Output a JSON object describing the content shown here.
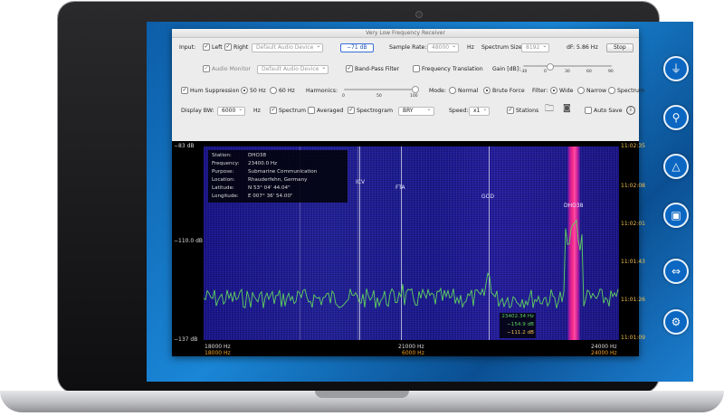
{
  "window": {
    "title": "Very Low Frequency Receiver"
  },
  "row1": {
    "input_label": "Input:",
    "left_label": "Left",
    "right_label": "Right",
    "device": "Default Audio Device",
    "level": "−71 dB",
    "sample_rate_label": "Sample Rate:",
    "sample_rate": "48000",
    "hz": "Hz",
    "spectrum_size_label": "Spectrum Size:",
    "spectrum_size": "8192",
    "df": "dF: 5.86 Hz",
    "stop_label": "Stop"
  },
  "row2": {
    "audio_monitor_label": "Audio Monitor",
    "device": "Default Audio Device",
    "bandpass_label": "Band-Pass Filter",
    "freq_translation_label": "Frequency Translation",
    "gain_label": "Gain [dB]:",
    "gain_ticks": [
      "-30",
      "0",
      "30",
      "60",
      "90"
    ],
    "gain_value": 0.3
  },
  "row3": {
    "hum_label": "Hum Suppression",
    "hz50": "50 Hz",
    "hz60": "60 Hz",
    "harmonics_label": "Harmonics:",
    "harm_ticks": [
      "0",
      "50",
      "100"
    ],
    "harm_value": 1.0,
    "mode_label": "Mode:",
    "normal": "Normal",
    "brute": "Brute Force",
    "filter_label": "Filter:",
    "wide": "Wide",
    "narrow": "Narrow",
    "spectrum": "Spectrum"
  },
  "row4": {
    "display_bw_label": "Display BW:",
    "bw": "6000",
    "hz": "Hz",
    "spectrum_label": "Spectrum",
    "averaged_label": "Averaged",
    "spectrogram_label": "Spectrogram",
    "palette": "BRY",
    "speed_label": "Speed:",
    "speed": "x1",
    "stations_label": "Stations",
    "autosave_label": "Auto Save"
  },
  "plot": {
    "y_top": "−83 dB",
    "y_mid": "−110.0 dB",
    "y_bot": "−137 dB",
    "times": [
      "11:02:35",
      "11:02:08",
      "11:02:01",
      "11:01:43",
      "11:01:26",
      "11:01:09"
    ],
    "x_left": "18000 Hz",
    "x_mid": "21000 Hz",
    "x_right": "24000 Hz",
    "x_left_o": "18000 Hz",
    "x_mid_o": "6000 Hz",
    "x_right_o": "24000 Hz",
    "stations": {
      "icv": "ICV",
      "fta": "FTA",
      "god": "GOD",
      "dho": "DHO38"
    },
    "info": {
      "station_k": "Station:",
      "station_v": "DHO38",
      "freq_k": "Frequency:",
      "freq_v": "23400.0 Hz",
      "purpose_k": "Purpose:",
      "purpose_v": "Submarine Communication",
      "location_k": "Location:",
      "location_v": "Rhauderfehn, Germany",
      "lat_k": "Latitude:",
      "lat_v": "N 53° 04' 44.04\"",
      "lon_k": "Longitude:",
      "lon_v": "E 007° 36' 54.00\""
    },
    "readout": {
      "hz": "23402.34 Hz",
      "db1": "−154.9 dB",
      "db2": "−111.2 dB"
    }
  },
  "colors": {
    "accent": "#1a86d6",
    "spectrum_line": "#5fd35f",
    "hot_band": "#ff2d8a",
    "time_axis": "#f0c050"
  }
}
